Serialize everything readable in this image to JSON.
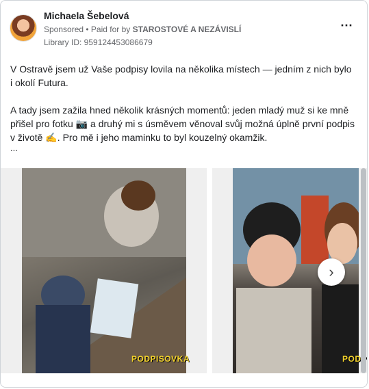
{
  "post": {
    "author": "Michaela Šebelová",
    "sponsored": "Sponsored",
    "paid_for_prefix": "• Paid for by",
    "sponsor": "STAROSTOVÉ A NEZÁVISLÍ",
    "library_id": "Library ID: 959124453086679",
    "more_icon": "⋯",
    "paragraph_1": "V Ostravě jsem už Vaše podpisy lovila na několika místech — jedním z nich bylo i okolí Futura.",
    "paragraph_2": "A tady jsem zažila hned několik krásných momentů: jeden mladý muž si ke mně přišel pro fotku 📷 a druhý mi s úsměvem věnoval svůj možná úplně první podpis v životě ✍️. Pro mě i jeho maminku to byl kouzelný okamžik.",
    "ellipsis": "..."
  },
  "carousel": {
    "slide_1_label": "PODPISOVKA",
    "slide_2_label": "PODPISOVKA",
    "next_icon": "›"
  },
  "colors": {
    "text": "#1c1e21",
    "secondary": "#65676b",
    "label": "#f2d22b"
  }
}
